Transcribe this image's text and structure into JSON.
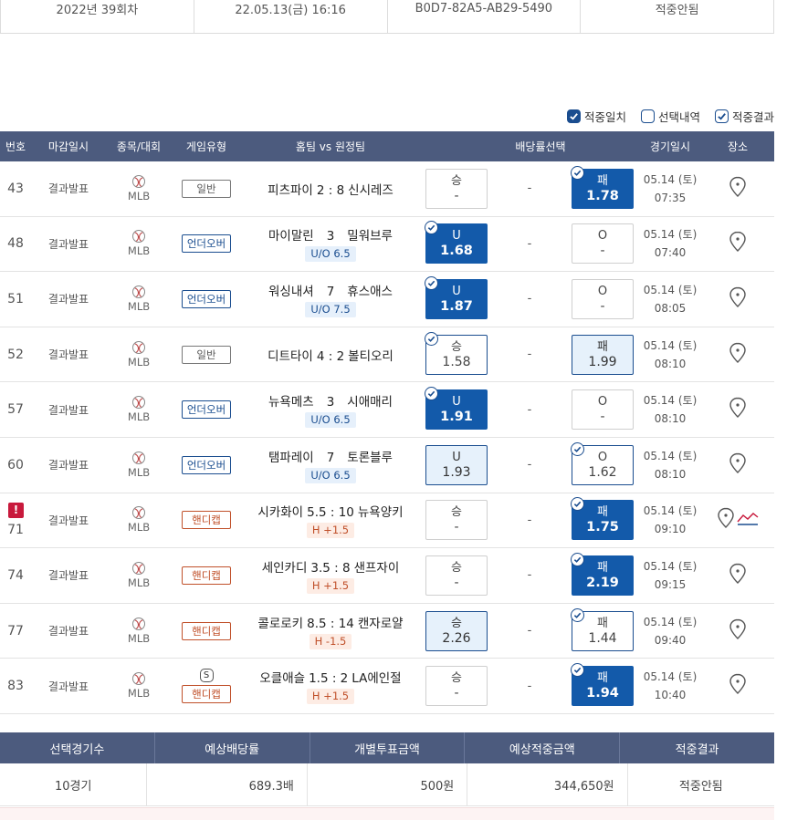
{
  "top_summary": [
    "2022년 39회차",
    "22.05.13(금) 16:16",
    "B0D7-82A5-AB29-5490",
    "적중안됨"
  ],
  "legend": [
    {
      "label": "적중일치",
      "checked": true
    },
    {
      "label": "선택내역",
      "checked": false
    },
    {
      "label": "적중결과",
      "checked": true
    }
  ],
  "headers": {
    "no": "번호",
    "deadline": "마감일시",
    "sport": "종목/대회",
    "type": "게임유형",
    "match": "홈팀 vs 원정팀",
    "odds": "배당률선택",
    "date": "경기일시",
    "place": "장소"
  },
  "colors": {
    "header_bg": "#4c5b7e",
    "selected": "#135aaa",
    "handicap": "#c0502a",
    "alert": "#c8193c"
  },
  "rows": [
    {
      "no": "43",
      "deadline": "결과발표",
      "sport": "MLB",
      "type": "일반",
      "type_kind": "general",
      "s_badge": "",
      "home": "피츠파이",
      "score": "2 : 8",
      "away": "신시레즈",
      "spaced": false,
      "subtag": "",
      "sub_kind": "",
      "left_label": "승",
      "left_value": "-",
      "left_state": "plain",
      "left_check": false,
      "mid": "-",
      "right_label": "패",
      "right_value": "1.78",
      "right_state": "sel",
      "right_check": true,
      "date": "05.14 (토)",
      "time": "07:35",
      "alert": false,
      "trend": false
    },
    {
      "no": "48",
      "deadline": "결과발표",
      "sport": "MLB",
      "type": "언더오버",
      "type_kind": "uo",
      "s_badge": "",
      "home": "마이말린",
      "score": "3",
      "away": "밀워브루",
      "spaced": true,
      "subtag": "U/O 6.5",
      "sub_kind": "uo",
      "left_label": "U",
      "left_value": "1.68",
      "left_state": "sel",
      "left_check": true,
      "mid": "-",
      "right_label": "O",
      "right_value": "-",
      "right_state": "plain",
      "right_check": false,
      "date": "05.14 (토)",
      "time": "07:40",
      "alert": false,
      "trend": false
    },
    {
      "no": "51",
      "deadline": "결과발표",
      "sport": "MLB",
      "type": "언더오버",
      "type_kind": "uo",
      "s_badge": "",
      "home": "워싱내셔",
      "score": "7",
      "away": "휴스애스",
      "spaced": true,
      "subtag": "U/O 7.5",
      "sub_kind": "uo",
      "left_label": "U",
      "left_value": "1.87",
      "left_state": "sel",
      "left_check": true,
      "mid": "-",
      "right_label": "O",
      "right_value": "-",
      "right_state": "plain",
      "right_check": false,
      "date": "05.14 (토)",
      "time": "08:05",
      "alert": false,
      "trend": false
    },
    {
      "no": "52",
      "deadline": "결과발표",
      "sport": "MLB",
      "type": "일반",
      "type_kind": "general",
      "s_badge": "",
      "home": "디트타이",
      "score": "4 : 2",
      "away": "볼티오리",
      "spaced": false,
      "subtag": "",
      "sub_kind": "",
      "left_label": "승",
      "left_value": "1.58",
      "left_state": "chose",
      "left_check": true,
      "mid": "-",
      "right_label": "패",
      "right_value": "1.99",
      "right_state": "hit",
      "right_check": false,
      "date": "05.14 (토)",
      "time": "08:10",
      "alert": false,
      "trend": false
    },
    {
      "no": "57",
      "deadline": "결과발표",
      "sport": "MLB",
      "type": "언더오버",
      "type_kind": "uo",
      "s_badge": "",
      "home": "뉴욕메츠",
      "score": "3",
      "away": "시애매리",
      "spaced": true,
      "subtag": "U/O 6.5",
      "sub_kind": "uo",
      "left_label": "U",
      "left_value": "1.91",
      "left_state": "sel",
      "left_check": true,
      "mid": "-",
      "right_label": "O",
      "right_value": "-",
      "right_state": "plain",
      "right_check": false,
      "date": "05.14 (토)",
      "time": "08:10",
      "alert": false,
      "trend": false
    },
    {
      "no": "60",
      "deadline": "결과발표",
      "sport": "MLB",
      "type": "언더오버",
      "type_kind": "uo",
      "s_badge": "",
      "home": "탬파레이",
      "score": "7",
      "away": "토론블루",
      "spaced": true,
      "subtag": "U/O 6.5",
      "sub_kind": "uo",
      "left_label": "U",
      "left_value": "1.93",
      "left_state": "hit",
      "left_check": false,
      "mid": "-",
      "right_label": "O",
      "right_value": "1.62",
      "right_state": "chose",
      "right_check": true,
      "date": "05.14 (토)",
      "time": "08:10",
      "alert": false,
      "trend": false
    },
    {
      "no": "71",
      "deadline": "결과발표",
      "sport": "MLB",
      "type": "핸디캡",
      "type_kind": "handi",
      "s_badge": "",
      "home": "시카화이",
      "score": "5.5 : 10",
      "away": "뉴욕양키",
      "spaced": false,
      "subtag": "H +1.5",
      "sub_kind": "handi",
      "left_label": "승",
      "left_value": "-",
      "left_state": "plain",
      "left_check": false,
      "mid": "-",
      "right_label": "패",
      "right_value": "1.75",
      "right_state": "sel",
      "right_check": true,
      "date": "05.14 (토)",
      "time": "09:10",
      "alert": true,
      "trend": true
    },
    {
      "no": "74",
      "deadline": "결과발표",
      "sport": "MLB",
      "type": "핸디캡",
      "type_kind": "handi",
      "s_badge": "",
      "home": "세인카디",
      "score": "3.5 : 8",
      "away": "샌프자이",
      "spaced": false,
      "subtag": "H +1.5",
      "sub_kind": "handi",
      "left_label": "승",
      "left_value": "-",
      "left_state": "plain",
      "left_check": false,
      "mid": "-",
      "right_label": "패",
      "right_value": "2.19",
      "right_state": "sel",
      "right_check": true,
      "date": "05.14 (토)",
      "time": "09:15",
      "alert": false,
      "trend": false
    },
    {
      "no": "77",
      "deadline": "결과발표",
      "sport": "MLB",
      "type": "핸디캡",
      "type_kind": "handi",
      "s_badge": "",
      "home": "콜로로키",
      "score": "8.5 : 14",
      "away": "캔자로얄",
      "spaced": false,
      "subtag": "H -1.5",
      "sub_kind": "handi",
      "left_label": "승",
      "left_value": "2.26",
      "left_state": "hit",
      "left_check": false,
      "mid": "-",
      "right_label": "패",
      "right_value": "1.44",
      "right_state": "chose",
      "right_check": true,
      "date": "05.14 (토)",
      "time": "09:40",
      "alert": false,
      "trend": false
    },
    {
      "no": "83",
      "deadline": "결과발표",
      "sport": "MLB",
      "type": "핸디캡",
      "type_kind": "handi",
      "s_badge": "S",
      "home": "오클애슬",
      "score": "1.5 : 2",
      "away": "LA에인절",
      "spaced": false,
      "subtag": "H +1.5",
      "sub_kind": "handi",
      "left_label": "승",
      "left_value": "-",
      "left_state": "plain",
      "left_check": false,
      "mid": "-",
      "right_label": "패",
      "right_value": "1.94",
      "right_state": "sel",
      "right_check": true,
      "date": "05.14 (토)",
      "time": "10:40",
      "alert": false,
      "trend": false
    }
  ],
  "summary": {
    "headers": [
      "선택경기수",
      "예상배당률",
      "개별투표금액",
      "예상적중금액",
      "적중결과"
    ],
    "values": [
      "10경기",
      "689.3배",
      "500원",
      "344,650원",
      "적중안됨"
    ]
  }
}
